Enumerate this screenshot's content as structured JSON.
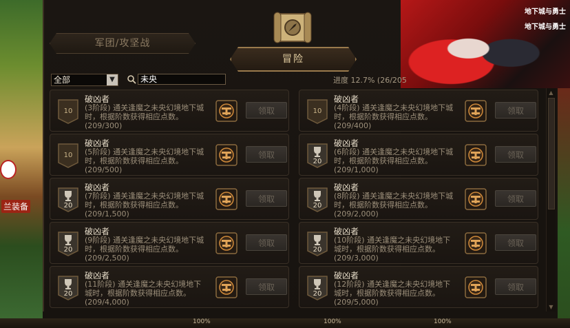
{
  "colors": {
    "panel_bg": "#1b1612",
    "accent_gold": "#9a7a4c",
    "text_main": "#e6dcc8",
    "text_muted": "#9c8f7a"
  },
  "scenery": {
    "label": "兰装备"
  },
  "banner": {
    "logo": "地下城与勇士"
  },
  "tabs": {
    "guild": "军团/攻坚战",
    "adventure": "冒险"
  },
  "filter": {
    "category_selected": "全部",
    "search_value": "未央",
    "progress_text": "进度 12.7% (26/205"
  },
  "achievements": [
    {
      "title": "破凶者",
      "badge_type": "plain",
      "badge_value": "10",
      "desc": "(3阶段) 通关逢魔之未央幻境地下城时，根据阶数获得相应点数。",
      "count": "(209/300)",
      "button": "领取"
    },
    {
      "title": "破凶者",
      "badge_type": "plain",
      "badge_value": "10",
      "desc": "(4阶段) 通关逢魔之未央幻境地下城时，根据阶数获得相应点数。",
      "count": "(209/400)",
      "button": "领取"
    },
    {
      "title": "破凶者",
      "badge_type": "plain",
      "badge_value": "10",
      "desc": "(5阶段) 通关逢魔之未央幻境地下城时，根据阶数获得相应点数。",
      "count": "(209/500)",
      "button": "领取"
    },
    {
      "title": "破凶者",
      "badge_type": "trophy",
      "badge_value": "20",
      "desc": "(6阶段) 通关逢魔之未央幻境地下城时，根据阶数获得相应点数。",
      "count": "(209/1,000)",
      "button": "领取"
    },
    {
      "title": "破凶者",
      "badge_type": "trophy",
      "badge_value": "20",
      "desc": "(7阶段) 通关逢魔之未央幻境地下城时，根据阶数获得相应点数。",
      "count": "(209/1,500)",
      "button": "领取"
    },
    {
      "title": "破凶者",
      "badge_type": "trophy",
      "badge_value": "20",
      "desc": "(8阶段) 通关逢魔之未央幻境地下城时，根据阶数获得相应点数。",
      "count": "(209/2,000)",
      "button": "领取"
    },
    {
      "title": "破凶者",
      "badge_type": "trophy",
      "badge_value": "20",
      "desc": "(9阶段) 通关逢魔之未央幻境地下城时，根据阶数获得相应点数。",
      "count": "(209/2,500)",
      "button": "领取"
    },
    {
      "title": "破凶者",
      "badge_type": "trophy",
      "badge_value": "20",
      "desc": "(10阶段) 通关逢魔之未央幻境地下城时，根据阶数获得相应点数。",
      "count": "(209/3,000)",
      "button": "领取"
    },
    {
      "title": "破凶者",
      "badge_type": "trophy",
      "badge_value": "20",
      "desc": "(11阶段) 通关逢魔之未央幻境地下城时，根据阶数获得相应点数。",
      "count": "(209/4,000)",
      "button": "领取"
    },
    {
      "title": "破凶者",
      "badge_type": "trophy",
      "badge_value": "20",
      "desc": "(12阶段) 通关逢魔之未央幻境地下城时，根据阶数获得相应点数。",
      "count": "(209/5,000)",
      "button": "领取"
    }
  ],
  "taskbar": {
    "pct_a": "100%",
    "pct_b": "100%",
    "pct_c": "100%"
  }
}
